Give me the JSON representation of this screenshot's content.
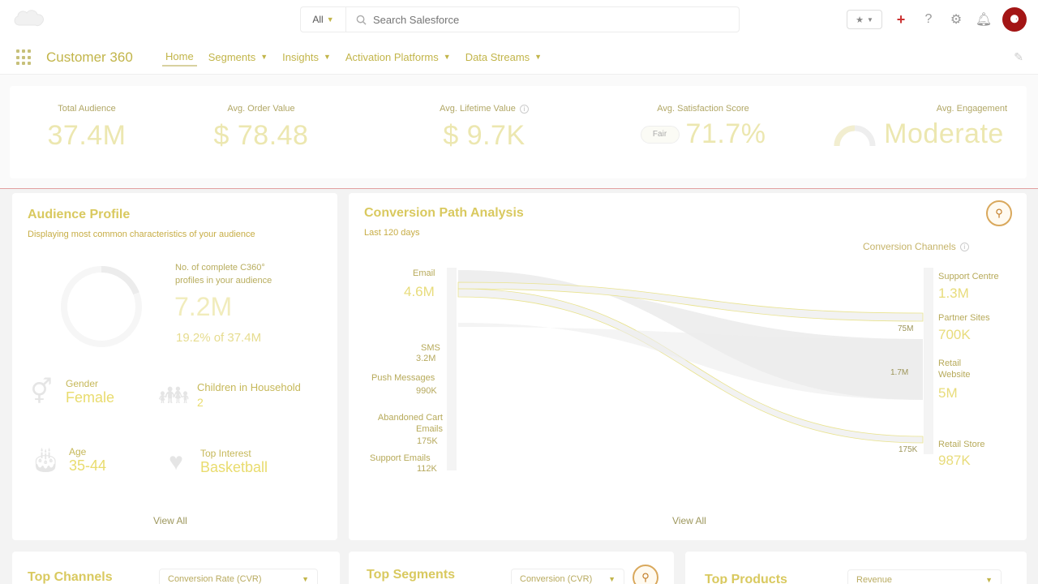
{
  "header": {
    "scope": "All",
    "search_placeholder": "Search Salesforce"
  },
  "nav": {
    "app_name": "Customer 360",
    "items": [
      {
        "label": "Home",
        "dropdown": false
      },
      {
        "label": "Segments",
        "dropdown": true
      },
      {
        "label": "Insights",
        "dropdown": true
      },
      {
        "label": "Activation Platforms",
        "dropdown": true
      },
      {
        "label": "Data Streams",
        "dropdown": true
      }
    ]
  },
  "metrics": [
    {
      "label": "Total Audience",
      "value": "37.4M"
    },
    {
      "label": "Avg. Order Value",
      "value": "$ 78.48"
    },
    {
      "label": "Avg. Lifetime Value",
      "value": "$ 9.7K"
    },
    {
      "label": "Avg. Satisfaction Score",
      "value": "71.7%",
      "badge": "Fair"
    },
    {
      "label": "Avg. Engagement",
      "value": "Moderate"
    }
  ],
  "audience_profile": {
    "title": "Audience Profile",
    "subtitle": "Displaying most common characteristics of your audience",
    "complete_label_line1": "No. of complete C360°",
    "complete_label_line2": "profiles in your audience",
    "complete_value": "7.2M",
    "complete_pct": "19.2% of 37.4M",
    "complete_fraction": 0.192,
    "attributes": {
      "gender_label": "Gender",
      "gender_value": "Female",
      "children_label": "Children in Household",
      "children_value": "2",
      "age_label": "Age",
      "age_value": "35-44",
      "interest_label": "Top Interest",
      "interest_value": "Basketball"
    },
    "view_all": "View All"
  },
  "conversion": {
    "title": "Conversion Path Analysis",
    "subtitle": "Last 120 days",
    "channels_label": "Conversion Channels",
    "sources": [
      {
        "name": "Email",
        "value": "4.6M",
        "large": true
      },
      {
        "name": "SMS",
        "value": "3.2M"
      },
      {
        "name": "Push Messages",
        "value": "990K"
      },
      {
        "name": "Abandoned Cart Emails",
        "value": "175K"
      },
      {
        "name": "Support Emails",
        "value": "112K"
      }
    ],
    "targets": [
      {
        "name": "Support Centre",
        "value": "1.3M"
      },
      {
        "name": "Partner Sites",
        "value": "700K"
      },
      {
        "name": "Retail Website",
        "value": "5M"
      },
      {
        "name": "Retail Store",
        "value": "987K"
      }
    ],
    "flow_labels": [
      "75M",
      "1.7M",
      "175K"
    ],
    "view_all": "View All"
  },
  "bottom": {
    "top_channels_title": "Top Channels",
    "top_channels_select": "Conversion Rate (CVR)",
    "top_segments_title": "Top Segments",
    "top_segments_select": "Conversion (CVR)",
    "top_products_title": "Top Products",
    "top_products_select": "Revenue"
  },
  "icons": {
    "logo": "salesforce-cloud-logo",
    "search": "search-icon",
    "add": "plus-icon",
    "help": "help-icon",
    "settings": "gear-icon",
    "notifications": "bell-icon"
  },
  "colors": {
    "accent": "#e8dc7b",
    "alert_line": "#e1a0a0",
    "avatar": "#a31515"
  }
}
